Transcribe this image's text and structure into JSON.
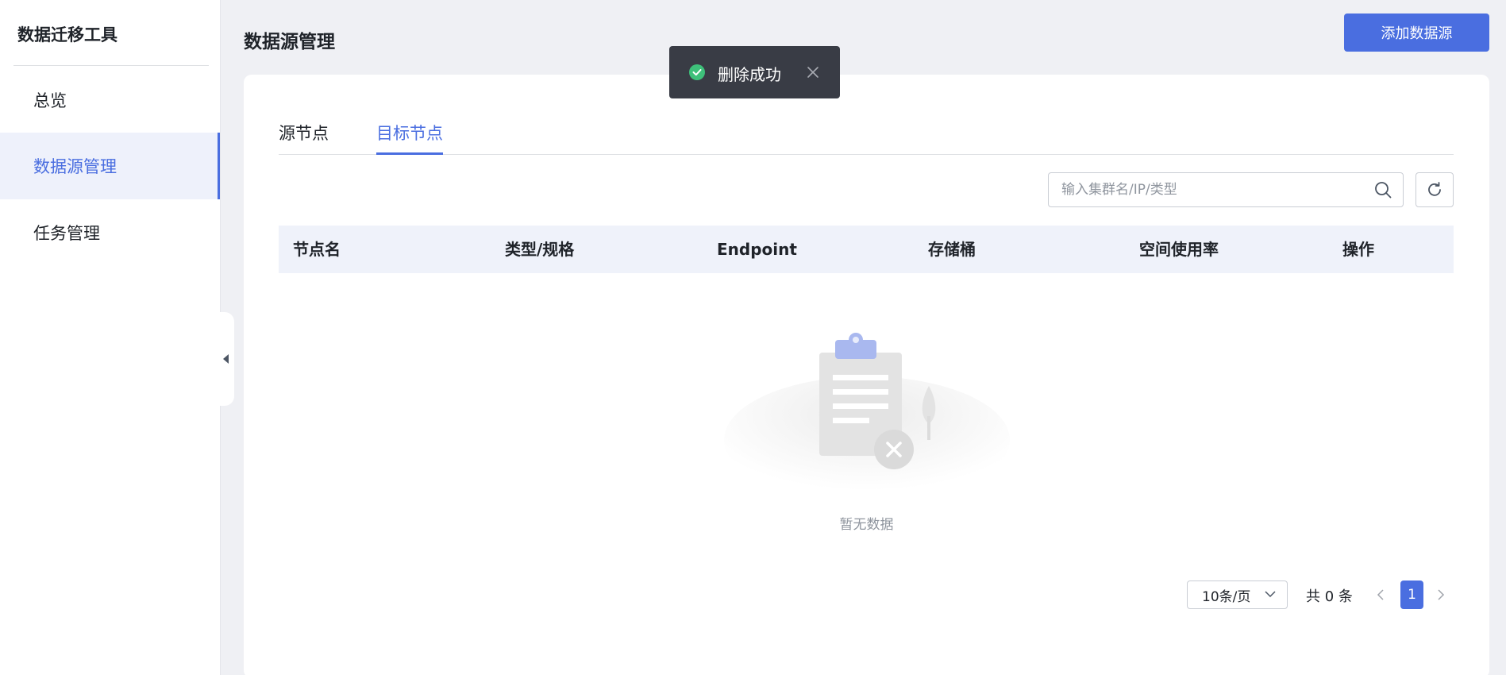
{
  "app": {
    "title": "数据迁移工具"
  },
  "sidebar": {
    "items": [
      {
        "label": "总览"
      },
      {
        "label": "数据源管理",
        "active": true
      },
      {
        "label": "任务管理"
      }
    ]
  },
  "header": {
    "title": "数据源管理",
    "add_button": "添加数据源"
  },
  "toast": {
    "message": "删除成功"
  },
  "tabs": [
    {
      "label": "源节点"
    },
    {
      "label": "目标节点",
      "active": true
    }
  ],
  "search": {
    "placeholder": "输入集群名/IP/类型",
    "value": ""
  },
  "table": {
    "columns": [
      "节点名",
      "类型/规格",
      "Endpoint",
      "存储桶",
      "空间使用率",
      "操作"
    ],
    "rows": []
  },
  "empty_state": {
    "text": "暂无数据"
  },
  "pagination": {
    "page_size": "10条/页",
    "total": "共 0 条",
    "current_page": "1"
  },
  "colors": {
    "accent": "#4a6ee0",
    "toast_bg": "#393c45",
    "success": "#3ec07a"
  }
}
